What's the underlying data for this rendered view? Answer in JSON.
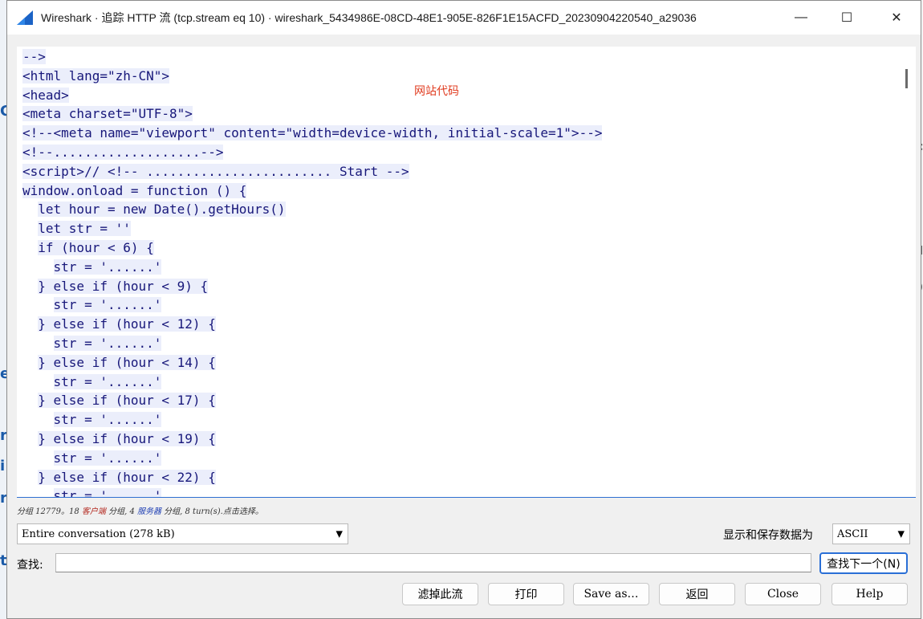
{
  "window": {
    "title": "Wireshark · 追踪 HTTP 流 (tcp.stream eq 10) · wireshark_5434986E-08CD-48E1-905E-826F1E15ACFD_20230904220540_a29036",
    "minimize_glyph": "—",
    "maximize_glyph": "☐",
    "close_glyph": "✕",
    "icon": "wireshark-fin-icon"
  },
  "background": {
    "left_glyphs": [
      "C",
      "e",
      "r",
      "i",
      "r",
      "t"
    ],
    "right_glyphs": [
      "l",
      ")",
      "c"
    ]
  },
  "annotation": "网站代码",
  "code_lines": [
    "-->",
    "<html lang=\"zh-CN\">",
    "<head>",
    "<meta charset=\"UTF-8\">",
    "<!--<meta name=\"viewport\" content=\"width=device-width, initial-scale=1\">-->",
    "<!--...................-->",
    "<script>// <!-- ........................ Start -->",
    "window.onload = function () {",
    "  let hour = new Date().getHours()",
    "  let str = ''",
    "  if (hour < 6) {",
    "    str = '......'",
    "  } else if (hour < 9) {",
    "    str = '......'",
    "  } else if (hour < 12) {",
    "    str = '......'",
    "  } else if (hour < 14) {",
    "    str = '......'",
    "  } else if (hour < 17) {",
    "    str = '......'",
    "  } else if (hour < 19) {",
    "    str = '......'",
    "  } else if (hour < 22) {",
    "    str = '......'"
  ],
  "status": {
    "prefix": "分组 12779。18 ",
    "client": "客户端",
    "middle": " 分组, 4 ",
    "server": "服务器",
    "suffix": " 分组, 8 turn(s).点击选择。"
  },
  "conversation_select": {
    "value": "Entire conversation (278 kB)"
  },
  "show_save_label": "显示和保存数据为",
  "encoding_select": {
    "value": "ASCII"
  },
  "find": {
    "label": "查找:",
    "value": "",
    "next_button": "查找下一个(N)"
  },
  "buttons": {
    "filter_out": "滤掉此流",
    "print": "打印",
    "save_as": "Save as…",
    "back": "返回",
    "close": "Close",
    "help": "Help"
  },
  "colors": {
    "code_text": "#17177a",
    "code_highlight": "#ebeefb",
    "annotation": "#e03b1f",
    "focus_blue": "#2a6fd6"
  }
}
